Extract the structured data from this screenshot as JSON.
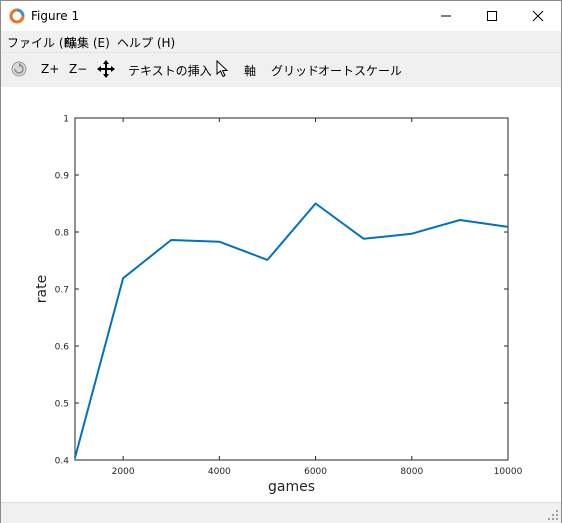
{
  "window": {
    "title": "Figure 1",
    "controls": [
      "minimize",
      "maximize",
      "close"
    ]
  },
  "menu": {
    "items": [
      "ファイル (F)",
      "編集 (E)",
      "ヘルプ (H)"
    ]
  },
  "toolbar": {
    "rotate_icon": "rotate-icon",
    "zoom_in": "Z+",
    "zoom_out": "Z−",
    "pan_icon": "pan-move-icon",
    "insert_text": "テキストの挿入",
    "pointer_icon": "pointer-icon",
    "axes": "軸",
    "grid": "グリッド",
    "autoscale": "オートスケール"
  },
  "colors": {
    "line": "#0072bd",
    "accent_icon_orange": "#e8742a",
    "accent_icon_blue": "#3a8fd6"
  },
  "chart_data": {
    "type": "line",
    "title": "",
    "xlabel": "games",
    "ylabel": "rate",
    "xlim": [
      1000,
      10000
    ],
    "ylim": [
      0.4,
      1.0
    ],
    "x_ticks": [
      2000,
      4000,
      6000,
      8000,
      10000
    ],
    "x_tick_labels": [
      "2000",
      "4000",
      "6000",
      "8000",
      "10000"
    ],
    "y_ticks": [
      0.4,
      0.5,
      0.6,
      0.7,
      0.8,
      0.9,
      1.0
    ],
    "y_tick_labels": [
      "0.4",
      "0.5",
      "0.6",
      "0.7",
      "0.8",
      "0.9",
      "1"
    ],
    "grid": false,
    "series": [
      {
        "x": [
          1000,
          2000,
          3000,
          4000,
          5000,
          6000,
          7000,
          8000,
          9000,
          10000
        ],
        "y": [
          0.404,
          0.719,
          0.786,
          0.783,
          0.751,
          0.85,
          0.788,
          0.797,
          0.821,
          0.809
        ]
      }
    ]
  }
}
